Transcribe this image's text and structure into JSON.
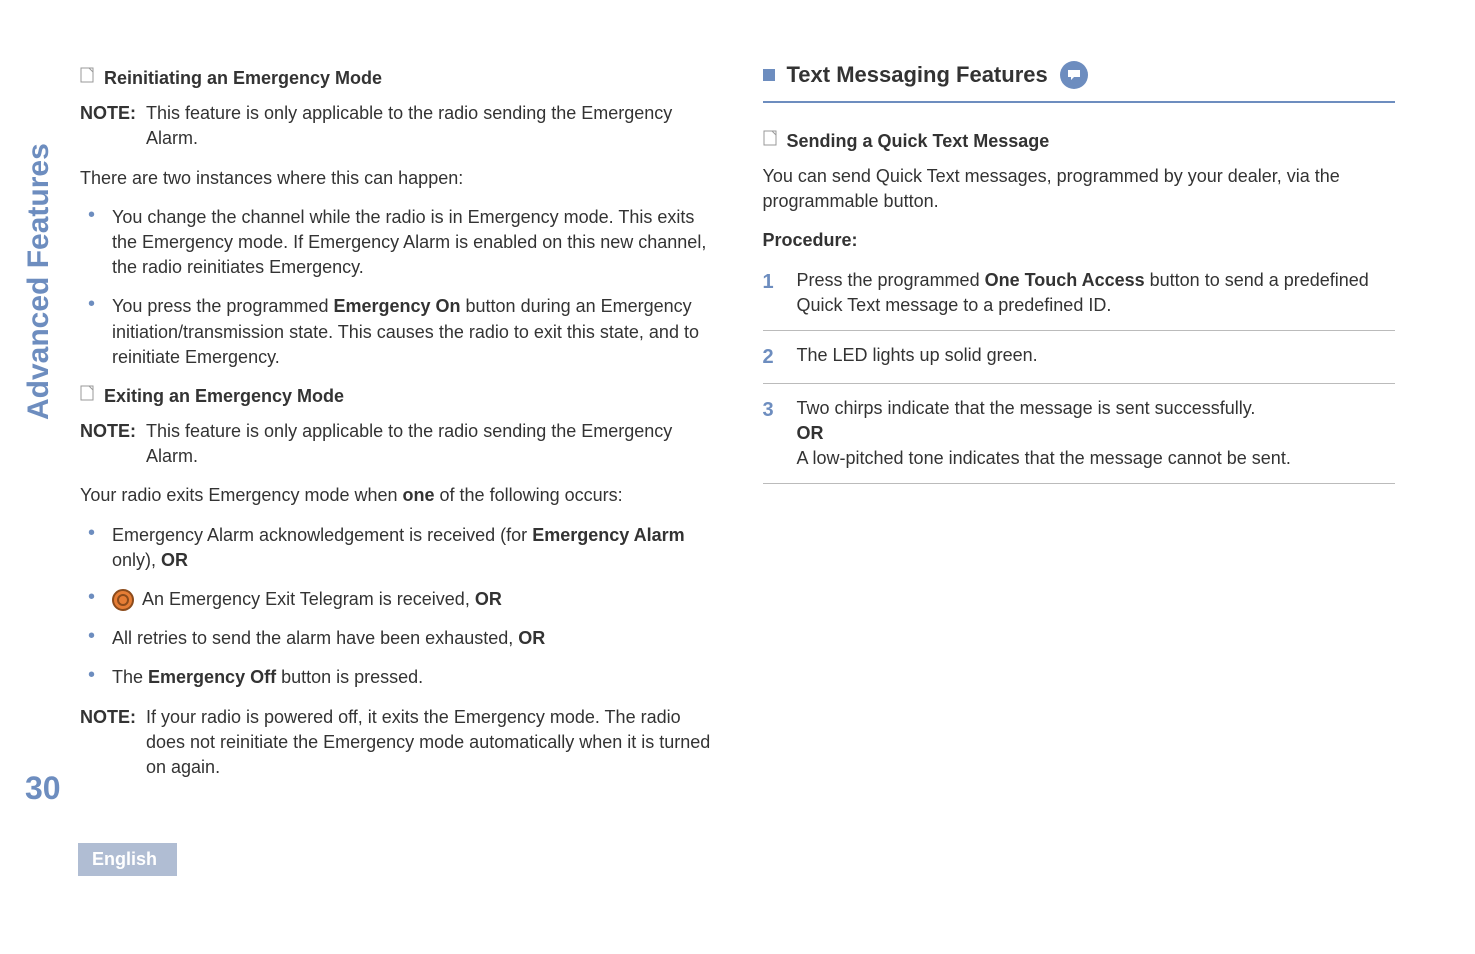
{
  "sidebar_title": "Advanced Features",
  "page_number": "30",
  "footer_language": "English",
  "left": {
    "h1": "Reinitiating an Emergency Mode",
    "note1_label": "NOTE:",
    "note1_text": "This feature is only applicable to the radio sending the Emergency Alarm.",
    "intro1": "There are two instances where this can happen:",
    "bullets1": {
      "a": "You change the channel while the radio is in Emergency mode. This exits the Emergency mode. If Emergency Alarm is enabled on this new channel, the radio reinitiates Emergency.",
      "b_pre": "You press the programmed ",
      "b_bold": "Emergency On",
      "b_post": " button during an Emergency initiation/transmission state. This causes the radio to exit this state, and to reinitiate Emergency."
    },
    "h2": "Exiting an Emergency Mode",
    "note2_label": "NOTE:",
    "note2_text": "This feature is only applicable to the radio sending the Emergency Alarm.",
    "intro2_pre": "Your radio exits Emergency mode when ",
    "intro2_bold": "one",
    "intro2_post": " of the following occurs:",
    "bullets2": {
      "a_pre": "Emergency Alarm acknowledgement is received (for ",
      "a_bold": "Emergency Alarm",
      "a_post": " only), ",
      "a_or": "OR",
      "b_text": " An Emergency Exit Telegram is received, ",
      "b_or": "OR",
      "c_text": "All retries to send the alarm have been exhausted, ",
      "c_or": "OR",
      "d_pre": "The ",
      "d_bold": "Emergency Off",
      "d_post": " button is pressed."
    },
    "note3_label": "NOTE:",
    "note3_text": "If your radio is powered off, it exits the Emergency mode. The radio does not reinitiate the Emergency mode automatically when it is turned on again."
  },
  "right": {
    "section": "Text Messaging Features",
    "h1": "Sending a Quick Text Message",
    "intro": "You can send Quick Text messages, programmed by your dealer, via the programmable button.",
    "proc": "Procedure:",
    "steps": {
      "s1_pre": "Press the programmed ",
      "s1_bold": "One Touch Access",
      "s1_post": " button to send a predefined Quick Text message to a predefined ID.",
      "s2": "The LED lights up solid green.",
      "s3_line1": "Two chirps indicate that the message is sent successfully.",
      "s3_or": "OR",
      "s3_line2": "A low-pitched tone indicates that the message cannot be sent."
    }
  }
}
